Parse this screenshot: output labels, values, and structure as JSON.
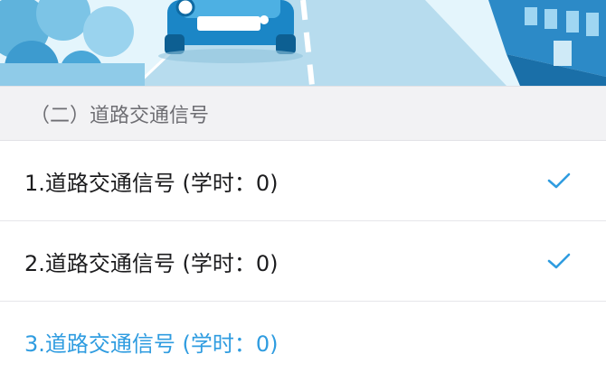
{
  "section": {
    "title": "（二）道路交通信号"
  },
  "lessons": [
    {
      "label": "1.道路交通信号 (学时：0)",
      "completed": true,
      "active": false
    },
    {
      "label": "2.道路交通信号 (学时：0)",
      "completed": true,
      "active": false
    },
    {
      "label": "3.道路交通信号 (学时：0)",
      "completed": false,
      "active": true
    }
  ],
  "colors": {
    "accent": "#2f9ce0",
    "header_bg": "#f2f2f4",
    "text": "#1c1c1e",
    "header_text": "#6e6e73"
  },
  "icons": {
    "completed": "checkmark-icon"
  }
}
